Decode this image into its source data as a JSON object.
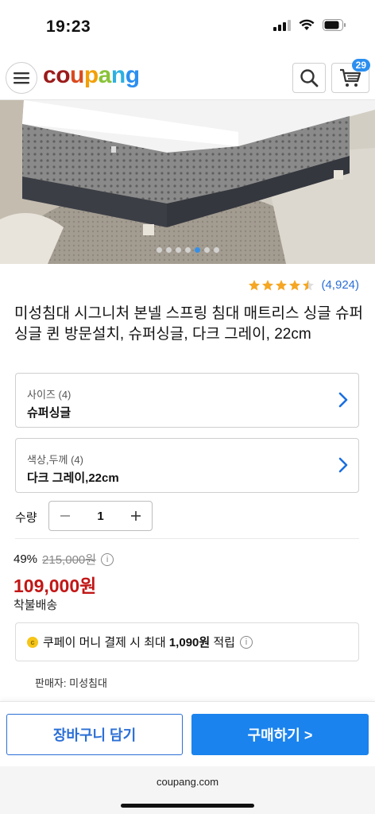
{
  "status_bar": {
    "time": "19:23"
  },
  "header": {
    "logo_letters": [
      {
        "ch": "c",
        "color": "#9b1b1b"
      },
      {
        "ch": "o",
        "color": "#9b1b1b"
      },
      {
        "ch": "u",
        "color": "#d94a1e"
      },
      {
        "ch": "p",
        "color": "#f2a007"
      },
      {
        "ch": "a",
        "color": "#8ac33a"
      },
      {
        "ch": "n",
        "color": "#2db0e0"
      },
      {
        "ch": "g",
        "color": "#2b8ff0"
      }
    ],
    "cart_count": "29"
  },
  "hero": {
    "slide_count": 7,
    "active_slide": 4
  },
  "product": {
    "rating_stars": 4.5,
    "review_count": "(4,924)",
    "title": "미성침대 시그니처 본넬 스프링 침대 매트리스 싱글 슈퍼싱글 퀸 방문설치, 슈퍼싱글, 다크 그레이, 22cm"
  },
  "options": [
    {
      "label": "사이즈 (4)",
      "value": "슈퍼싱글"
    },
    {
      "label": "색상,두께 (4)",
      "value": "다크 그레이,22cm"
    }
  ],
  "quantity": {
    "label": "수량",
    "value": "1"
  },
  "price": {
    "discount": "49%",
    "original": "215,000원",
    "sale": "109,000원",
    "shipping": "착불배송"
  },
  "cashback": {
    "prefix": "쿠페이 머니 결제 시 최대 ",
    "amount": "1,090원",
    "suffix": " 적립"
  },
  "seller": "판매자: 미성침대",
  "actions": {
    "add_to_cart": "장바구니 담기",
    "buy_now": "구매하기 >"
  },
  "browser": {
    "url": "coupang.com"
  },
  "colors": {
    "accent": "#1a83ee",
    "price_red": "#c21616",
    "star": "#f5a623"
  }
}
